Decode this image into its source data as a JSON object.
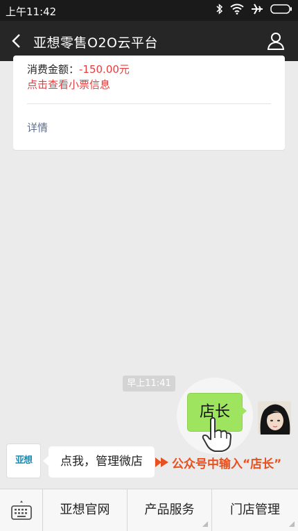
{
  "status": {
    "time": "上午11:42"
  },
  "header": {
    "title": "亚想零售O2O云平台"
  },
  "card": {
    "amount_label": "消费金额：",
    "amount_value": "-150.00元",
    "receipt_link": "点击查看小票信息",
    "detail_link": "详情"
  },
  "chat": {
    "timestamp": "早上11:41",
    "sent_message": "店长"
  },
  "hint": {
    "logo_text": "亚想",
    "bubble_text": "点我，管理微店",
    "instruction": "公众号中输入“店长”"
  },
  "menu": {
    "items": [
      {
        "label": "亚想官网"
      },
      {
        "label": "产品服务"
      },
      {
        "label": "门店管理"
      }
    ]
  },
  "colors": {
    "accent_red": "#e53d3d",
    "instruction_orange": "#e8501f",
    "sent_bubble": "#9ee45f",
    "link_blue": "#5e6f8d"
  }
}
